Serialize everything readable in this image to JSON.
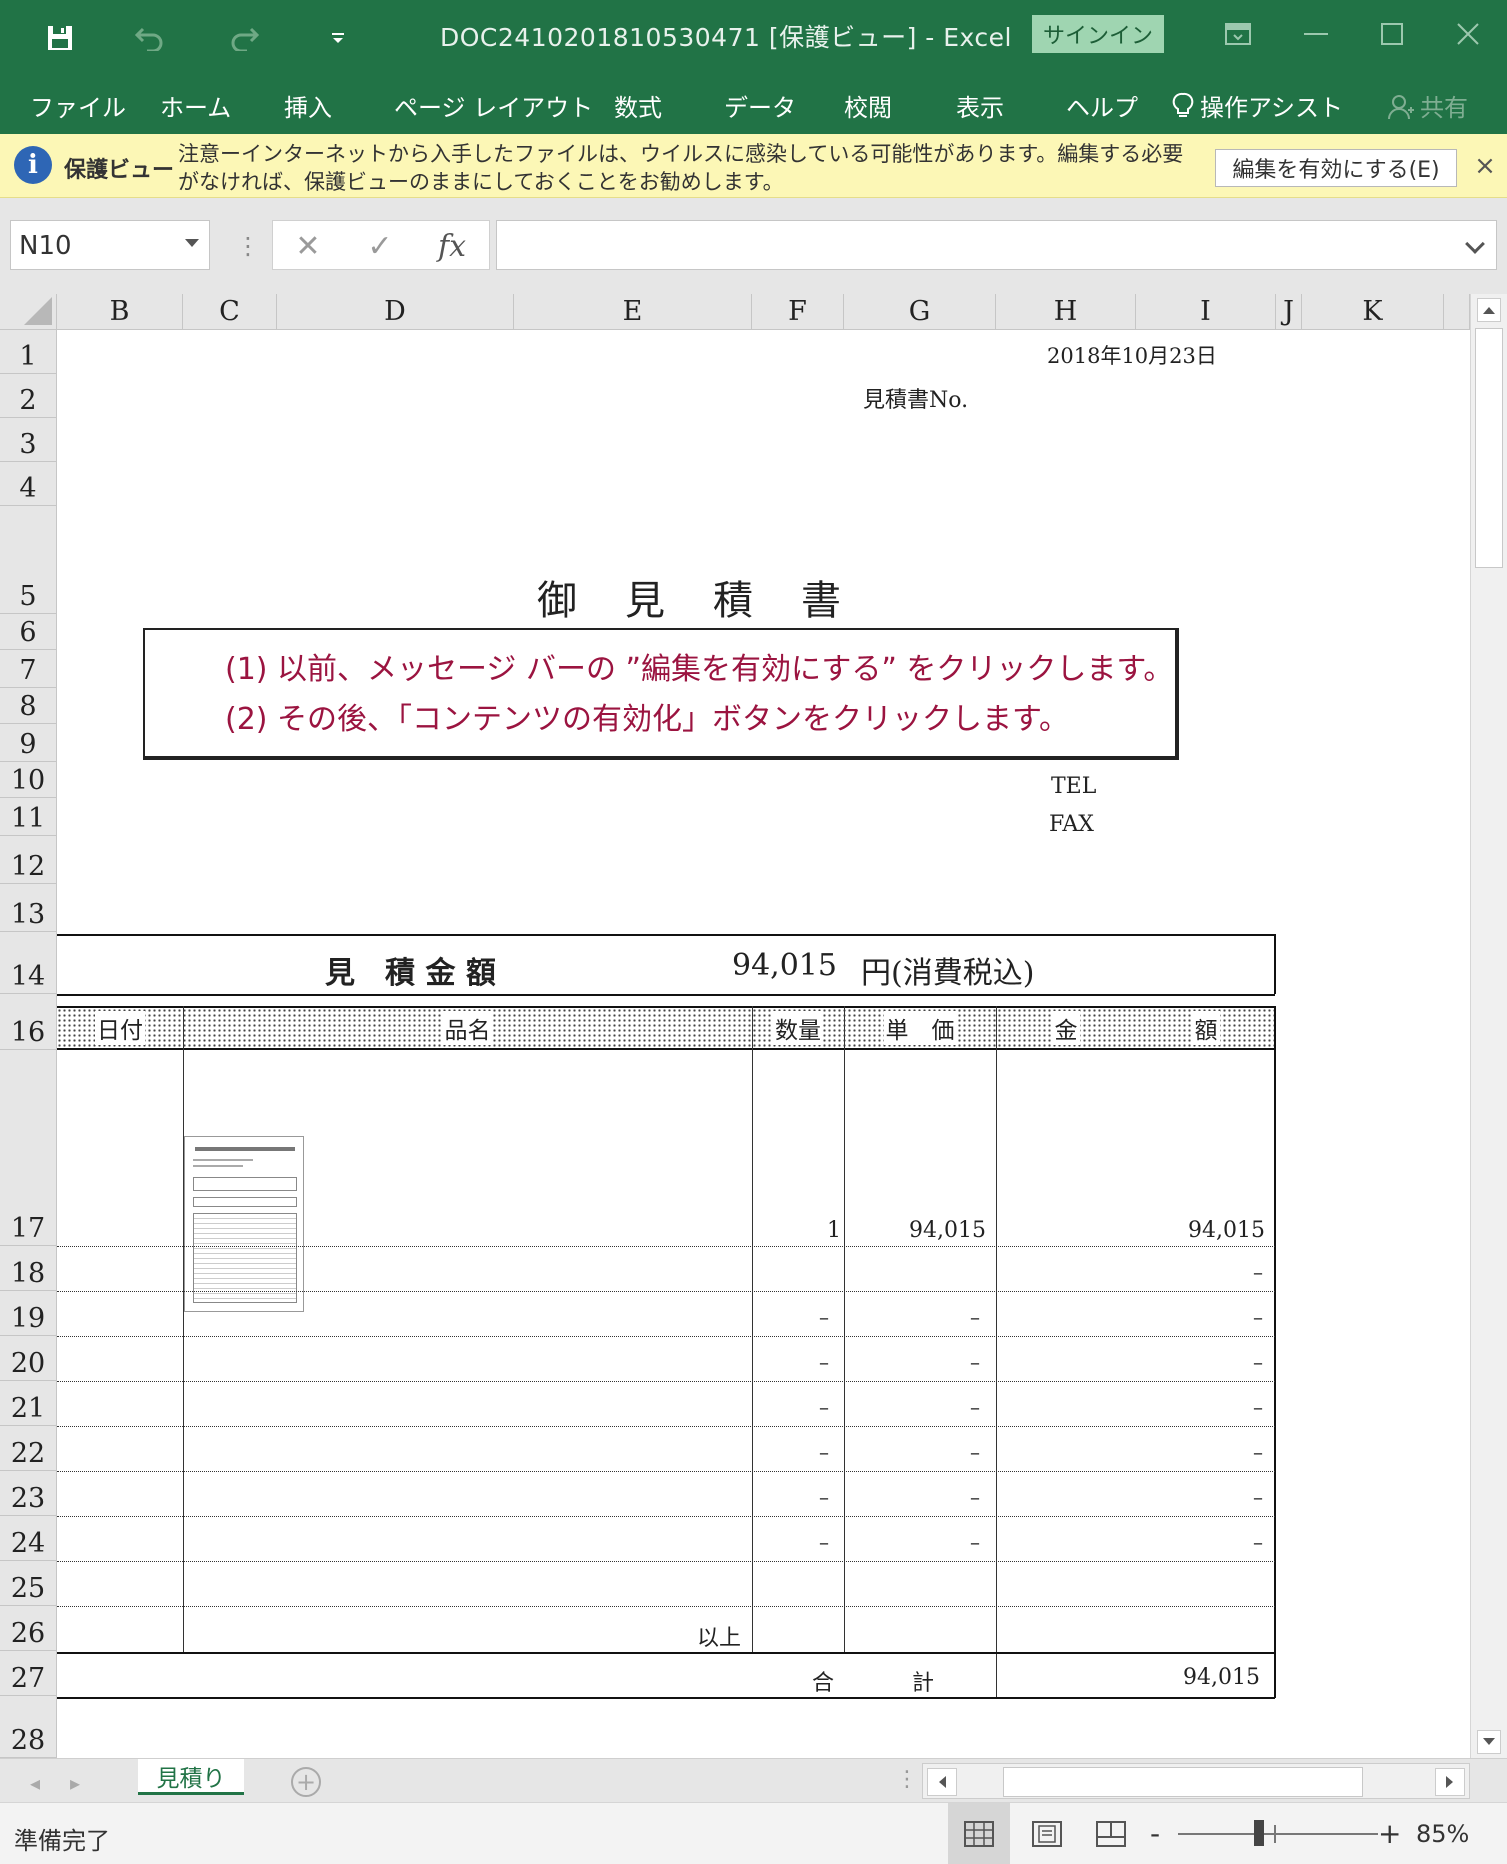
{
  "titlebar": {
    "title": "DOC2410201810530471  [保護ビュー]  -  Excel",
    "signin_label": "サインイン"
  },
  "ribbon": {
    "tabs": [
      "ファイル",
      "ホーム",
      "挿入",
      "ページ レイアウト",
      "数式",
      "データ",
      "校閲",
      "表示",
      "ヘルプ"
    ],
    "tell_me": "操作アシスト",
    "share": "共有"
  },
  "protected_view": {
    "title": "保護ビュー",
    "message": "注意ーインターネットから入手したファイルは、ウイルスに感染している可能性があります。編集する必要がなければ、保護ビューのままにしておくことをお勧めします。",
    "enable_button": "編集を有効にする(E)",
    "close_glyph": "×"
  },
  "formula_bar": {
    "name_box": "N10",
    "fx_label": "fx",
    "formula": ""
  },
  "columns": [
    "B",
    "C",
    "D",
    "E",
    "F",
    "G",
    "H",
    "I",
    "J",
    "K"
  ],
  "rows": [
    "1",
    "2",
    "3",
    "4",
    "5",
    "6",
    "7",
    "8",
    "9",
    "10",
    "11",
    "12",
    "13",
    "14",
    "16",
    "17",
    "18",
    "19",
    "20",
    "21",
    "22",
    "23",
    "24",
    "25",
    "26",
    "27",
    "28"
  ],
  "sheet": {
    "date": "2018年10月23日",
    "estimate_no_label": "見積書No.",
    "doc_title": "御　見　積　書",
    "tel_label": "TEL",
    "fax_label": "FAX",
    "amount_label": "見　積 金 額",
    "amount_value": "94,015",
    "amount_suffix": "円(消費税込)",
    "notice_line1": "(1) 以前、メッセージ バーの ”編集を有効にする” をクリックします。",
    "notice_line2": "(2) その後、「コンテンツの有効化」ボタンをクリックします。",
    "table_headers": {
      "date": "日付",
      "item": "品名",
      "qty": "数量",
      "unit_price": "単　価",
      "amount_left": "金",
      "amount_right": "額"
    },
    "item_row": {
      "qty": "1",
      "unit_price": "94,015",
      "amount": "94,015"
    },
    "dash": "–",
    "end_label": "以上",
    "total_label_a": "合",
    "total_label_b": "計",
    "total_value": "94,015"
  },
  "sheet_tabs": {
    "active": "見積り",
    "add_glyph": "+"
  },
  "statusbar": {
    "status": "準備完了",
    "zoom_minus": "-",
    "zoom_plus": "+",
    "zoom": "85%",
    "zoom_level_percent": 85
  },
  "colors": {
    "excel_green": "#217346",
    "notice_text": "#9b1440",
    "pv_background": "#fcf7b6"
  },
  "icons": [
    "save-icon",
    "undo-icon",
    "redo-icon",
    "customize-qat-icon",
    "ribbon-display-icon",
    "minimize-icon",
    "maximize-icon",
    "close-icon",
    "lightbulb-icon",
    "share-person-icon",
    "info-icon",
    "cancel-icon",
    "enter-icon",
    "normal-view-icon",
    "page-layout-view-icon",
    "page-break-view-icon"
  ]
}
